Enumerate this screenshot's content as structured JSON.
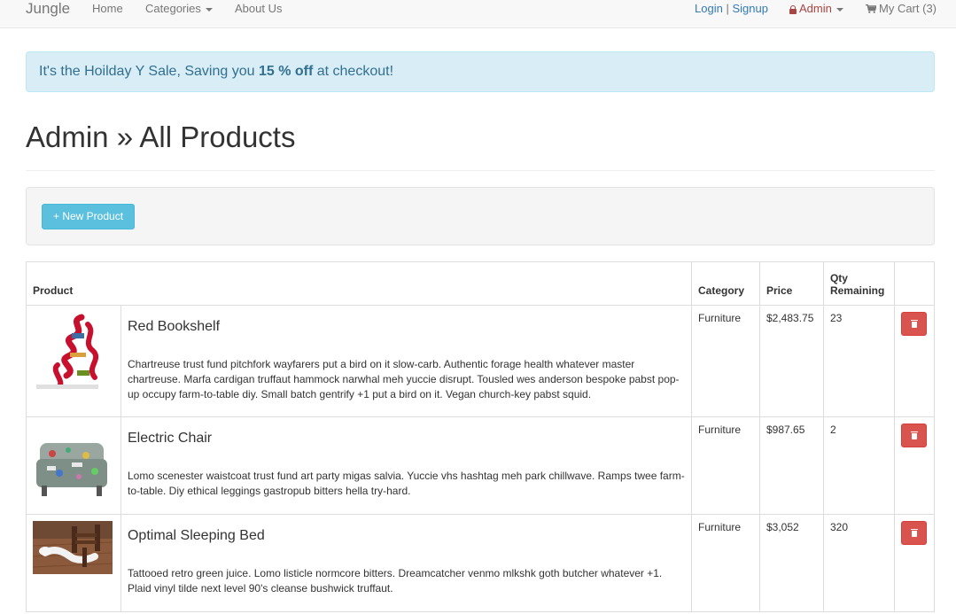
{
  "nav": {
    "brand": "Jungle",
    "home": "Home",
    "categories": "Categories",
    "about": "About Us",
    "login": "Login",
    "separator": "|",
    "signup": "Signup",
    "admin": "Admin",
    "cart": "My Cart (3)"
  },
  "alert": {
    "prefix": "It's the Hoilday Y Sale, Saving you ",
    "discount": "15 % off",
    "suffix": " at checkout!"
  },
  "page": {
    "title": "Admin » All Products",
    "new_product_label": "+ New Product"
  },
  "table": {
    "headers": {
      "product": "Product",
      "category": "Category",
      "price": "Price",
      "qty": "Qty Remaining"
    },
    "rows": [
      {
        "name": "Red Bookshelf",
        "description": "Chartreuse trust fund pitchfork wayfarers put a bird on it slow-carb. Authentic forage health whatever master chartreuse. Marfa cardigan truffaut hammock narwhal meh yuccie disrupt. Tousled wes anderson bespoke pabst pop-up occupy farm-to-table diy. Small batch gentrify +1 put a bird on it. Vegan church-key pabst squid.",
        "category": "Furniture",
        "price": "$2,483.75",
        "qty": "23"
      },
      {
        "name": "Electric Chair",
        "description": "Lomo scenester waistcoat trust fund art party migas salvia. Yuccie vhs hashtag meh park chillwave. Ramps twee farm-to-table. Diy ethical leggings gastropub bitters hella try-hard.",
        "category": "Furniture",
        "price": "$987.65",
        "qty": "2"
      },
      {
        "name": "Optimal Sleeping Bed",
        "description": "Tattooed retro green juice. Lomo listicle normcore bitters. Dreamcatcher venmo mlkshk goth butcher whatever +1. Plaid vinyl tilde next level 90's cleanse bushwick truffaut.",
        "category": "Furniture",
        "price": "$3,052",
        "qty": "320"
      }
    ]
  },
  "colors": {
    "alert_bg": "#d9edf7",
    "info_button": "#5bc0de",
    "danger_button": "#d9534f",
    "link": "#337ab7"
  }
}
